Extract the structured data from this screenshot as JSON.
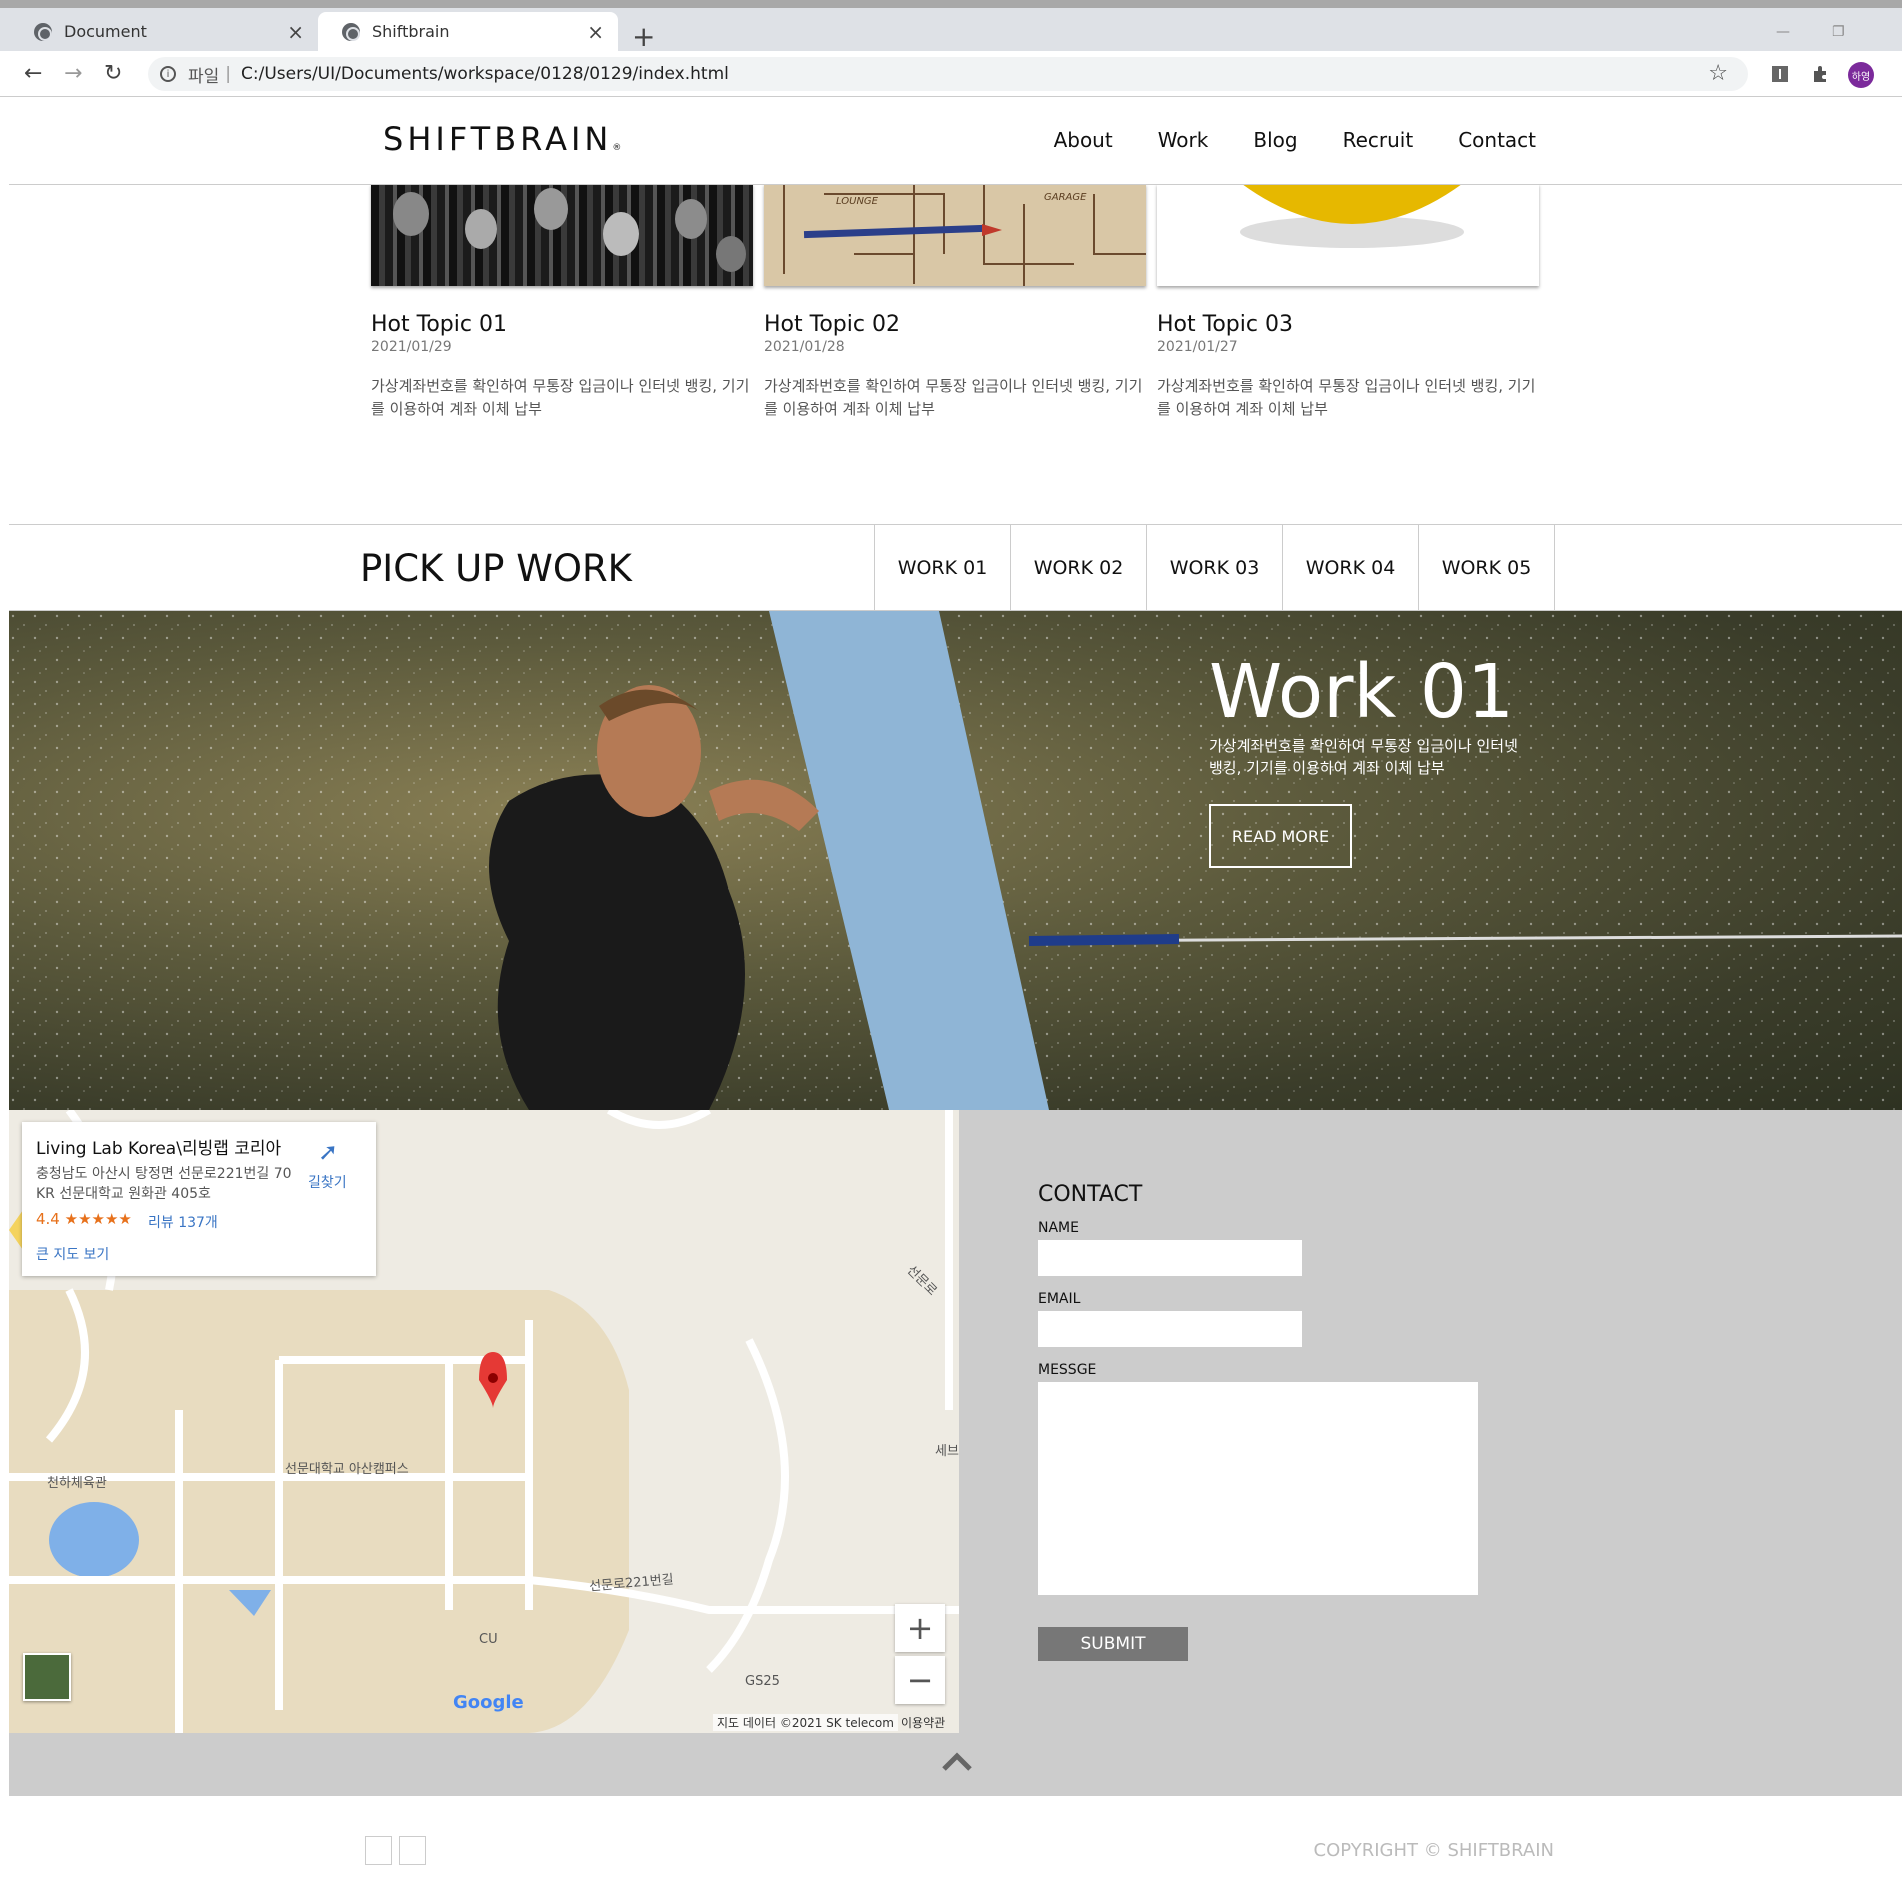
{
  "browser": {
    "tabs": [
      {
        "title": "Document",
        "active": false
      },
      {
        "title": "Shiftbrain",
        "active": true
      }
    ],
    "url_scheme_label": "파일",
    "url_separator": "|",
    "url": "C:/Users/UI/Documents/workspace/0128/0129/index.html",
    "profile_initials": "하영"
  },
  "header": {
    "logo": "SHIFTBRAIN",
    "logo_mark": "®",
    "nav": [
      "About",
      "Work",
      "Blog",
      "Recruit",
      "Contact"
    ]
  },
  "topics": [
    {
      "title": "Hot Topic 01",
      "date": "2021/01/29",
      "text": "가상계좌번호를 확인하여 무통장 입금이나 인터넷 뱅킹, 기기를 이용하여 계좌 이체 납부"
    },
    {
      "title": "Hot Topic 02",
      "date": "2021/01/28",
      "text": "가상계좌번호를 확인하여 무통장 입금이나 인터넷 뱅킹, 기기를 이용하여 계좌 이체 납부"
    },
    {
      "title": "Hot Topic 03",
      "date": "2021/01/27",
      "text": "가상계좌번호를 확인하여 무통장 입금이나 인터넷 뱅킹, 기기를 이용하여 계좌 이체 납부"
    }
  ],
  "topic_images": {
    "img2_labels": [
      "LOUNGE",
      "GARAGE"
    ]
  },
  "pickup": {
    "title": "PICK UP WORK",
    "tabs": [
      "WORK 01",
      "WORK 02",
      "WORK 03",
      "WORK 04",
      "WORK 05"
    ]
  },
  "hero": {
    "title": "Work 01",
    "desc": "가상계좌번호를 확인하여 무통장 입금이나 인터넷뱅킹, 기기를 이용하여 계좌 이체 납부",
    "button": "READ MORE"
  },
  "map": {
    "place_name": "Living Lab Korea\\리빙랩 코리아",
    "address": "충청남도 아산시 탕정면 선문로221번길 70 KR 선문대학교 원화관 405호",
    "rating": "4.4",
    "stars": "★★★★★",
    "reviews": "리뷰 137개",
    "larger_map": "큰 지도 보기",
    "directions": "길찾기",
    "labels": {
      "gym": "천하체육관",
      "campus": "선문대학교 아산캠퍼스",
      "road": "선문로221번길",
      "road2": "선문로",
      "cu": "CU",
      "gs": "GS25",
      "edge": "세브"
    },
    "google": "Google",
    "attribution": "지도 데이터 ©2021 SK telecom",
    "terms": "이용약관",
    "zoom_in": "+",
    "zoom_out": "−"
  },
  "contact": {
    "title": "CONTACT",
    "name_label": "NAME",
    "email_label": "EMAIL",
    "message_label": "MESSGE",
    "submit": "SUBMIT"
  },
  "footer": {
    "copyright": "COPYRIGHT © SHIFTBRAIN"
  }
}
